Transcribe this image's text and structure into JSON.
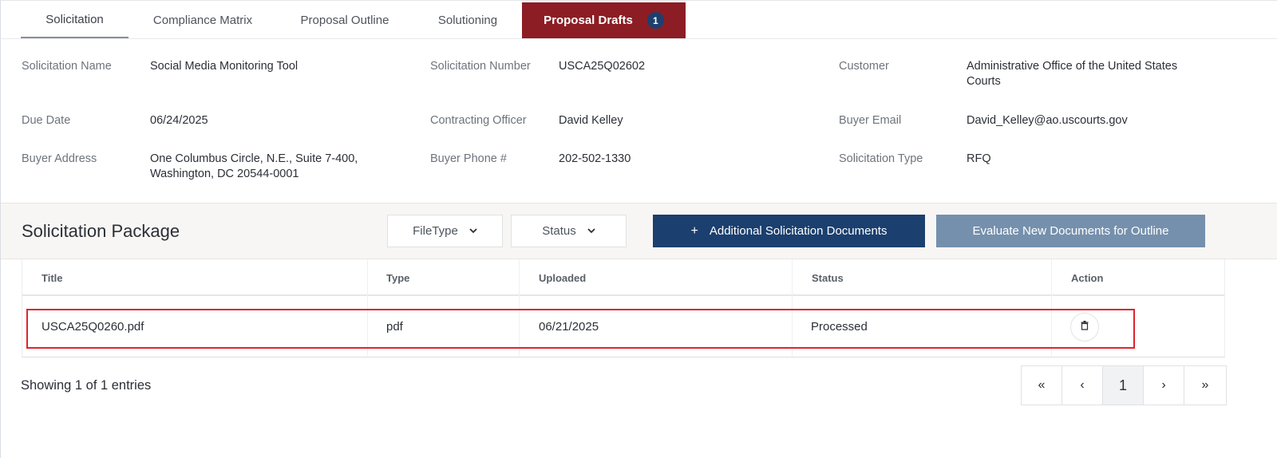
{
  "tabs": [
    {
      "label": "Solicitation"
    },
    {
      "label": "Compliance Matrix"
    },
    {
      "label": "Proposal Outline"
    },
    {
      "label": "Solutioning"
    },
    {
      "label": "Proposal Drafts",
      "badge": "1"
    }
  ],
  "info": {
    "solicitation_name_label": "Solicitation Name",
    "solicitation_name": "Social Media Monitoring Tool",
    "solicitation_number_label": "Solicitation Number",
    "solicitation_number": "USCA25Q02602",
    "customer_label": "Customer",
    "customer_line1": "Administrative Office of the United States",
    "customer_line2": "Courts",
    "due_date_label": "Due Date",
    "due_date": "06/24/2025",
    "contracting_officer_label": "Contracting Officer",
    "contracting_officer": "David Kelley",
    "buyer_email_label": "Buyer Email",
    "buyer_email": "David_Kelley@ao.uscourts.gov",
    "buyer_address_label": "Buyer Address",
    "buyer_address_line1": "One Columbus Circle, N.E., Suite 7-400,",
    "buyer_address_line2": "Washington, DC 20544-0001",
    "buyer_phone_label": "Buyer Phone #",
    "buyer_phone": "202-502-1330",
    "solicitation_type_label": "Solicitation Type",
    "solicitation_type": "RFQ"
  },
  "package": {
    "title": "Solicitation Package",
    "filetype_label": "FileType",
    "status_label": "Status",
    "add_docs_label": "Additional Solicitation Documents",
    "add_docs_icon": "+",
    "evaluate_label": "Evaluate New Documents for Outline"
  },
  "table": {
    "headers": [
      "Title",
      "Type",
      "Uploaded",
      "Status",
      "Action"
    ],
    "rows": [
      {
        "title": "USCA25Q0260.pdf",
        "type": "pdf",
        "uploaded": "06/21/2025",
        "status": "Processed",
        "action_icon": "trash-icon"
      }
    ]
  },
  "footer": {
    "showing": "Showing 1 of 1 entries",
    "pager": {
      "first": "«",
      "prev": "‹",
      "current": "1",
      "next": "›",
      "last": "»"
    }
  },
  "colors": {
    "active_tab": "#8c1d24",
    "primary_button": "#1b3f6e",
    "disabled_button": "#7590ac",
    "highlight_border": "#e0242e",
    "badge": "#1d3f6e"
  }
}
